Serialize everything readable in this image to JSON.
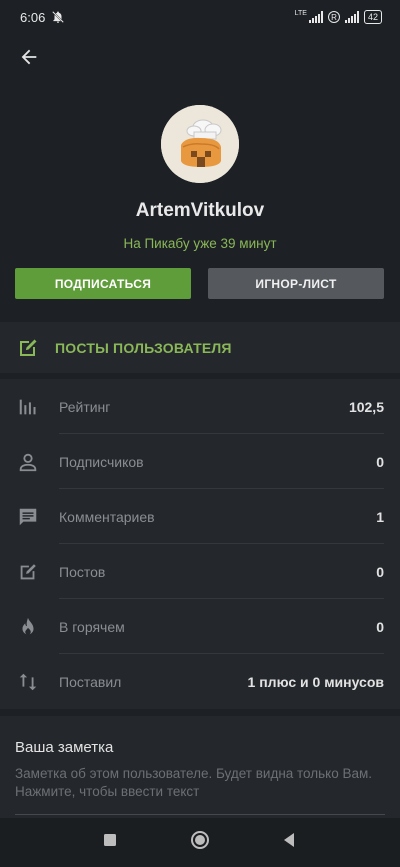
{
  "status_bar": {
    "time": "6:06",
    "network_label": "LTE",
    "battery": "42",
    "roaming_badge": "R"
  },
  "profile": {
    "username": "ArtemVitkulov",
    "since_text": "На Пикабу уже 39 минут",
    "subscribe_label": "ПОДПИСАТЬСЯ",
    "ignore_label": "ИГНОР-ЛИСТ"
  },
  "posts_link": {
    "label": "ПОСТЫ ПОЛЬЗОВАТЕЛЯ"
  },
  "stats": [
    {
      "icon": "rating-bars-icon",
      "label": "Рейтинг",
      "value": "102,5"
    },
    {
      "icon": "person-icon",
      "label": "Подписчиков",
      "value": "0"
    },
    {
      "icon": "comment-icon",
      "label": "Комментариев",
      "value": "1"
    },
    {
      "icon": "edit-icon",
      "label": "Постов",
      "value": "0"
    },
    {
      "icon": "flame-icon",
      "label": "В горячем",
      "value": "0"
    },
    {
      "icon": "sort-arrows-icon",
      "label": "Поставил",
      "value": "1 плюс и 0 минусов"
    }
  ],
  "note": {
    "title": "Ваша заметка",
    "placeholder": "Заметка об этом пользователе. Будет видна только Вам. Нажмите, чтобы ввести текст"
  },
  "colors": {
    "background": "#1d2125",
    "card": "#24282c",
    "accent_green": "#5f9c3a",
    "green_text": "#8ab758",
    "gray_button": "#55595e"
  }
}
